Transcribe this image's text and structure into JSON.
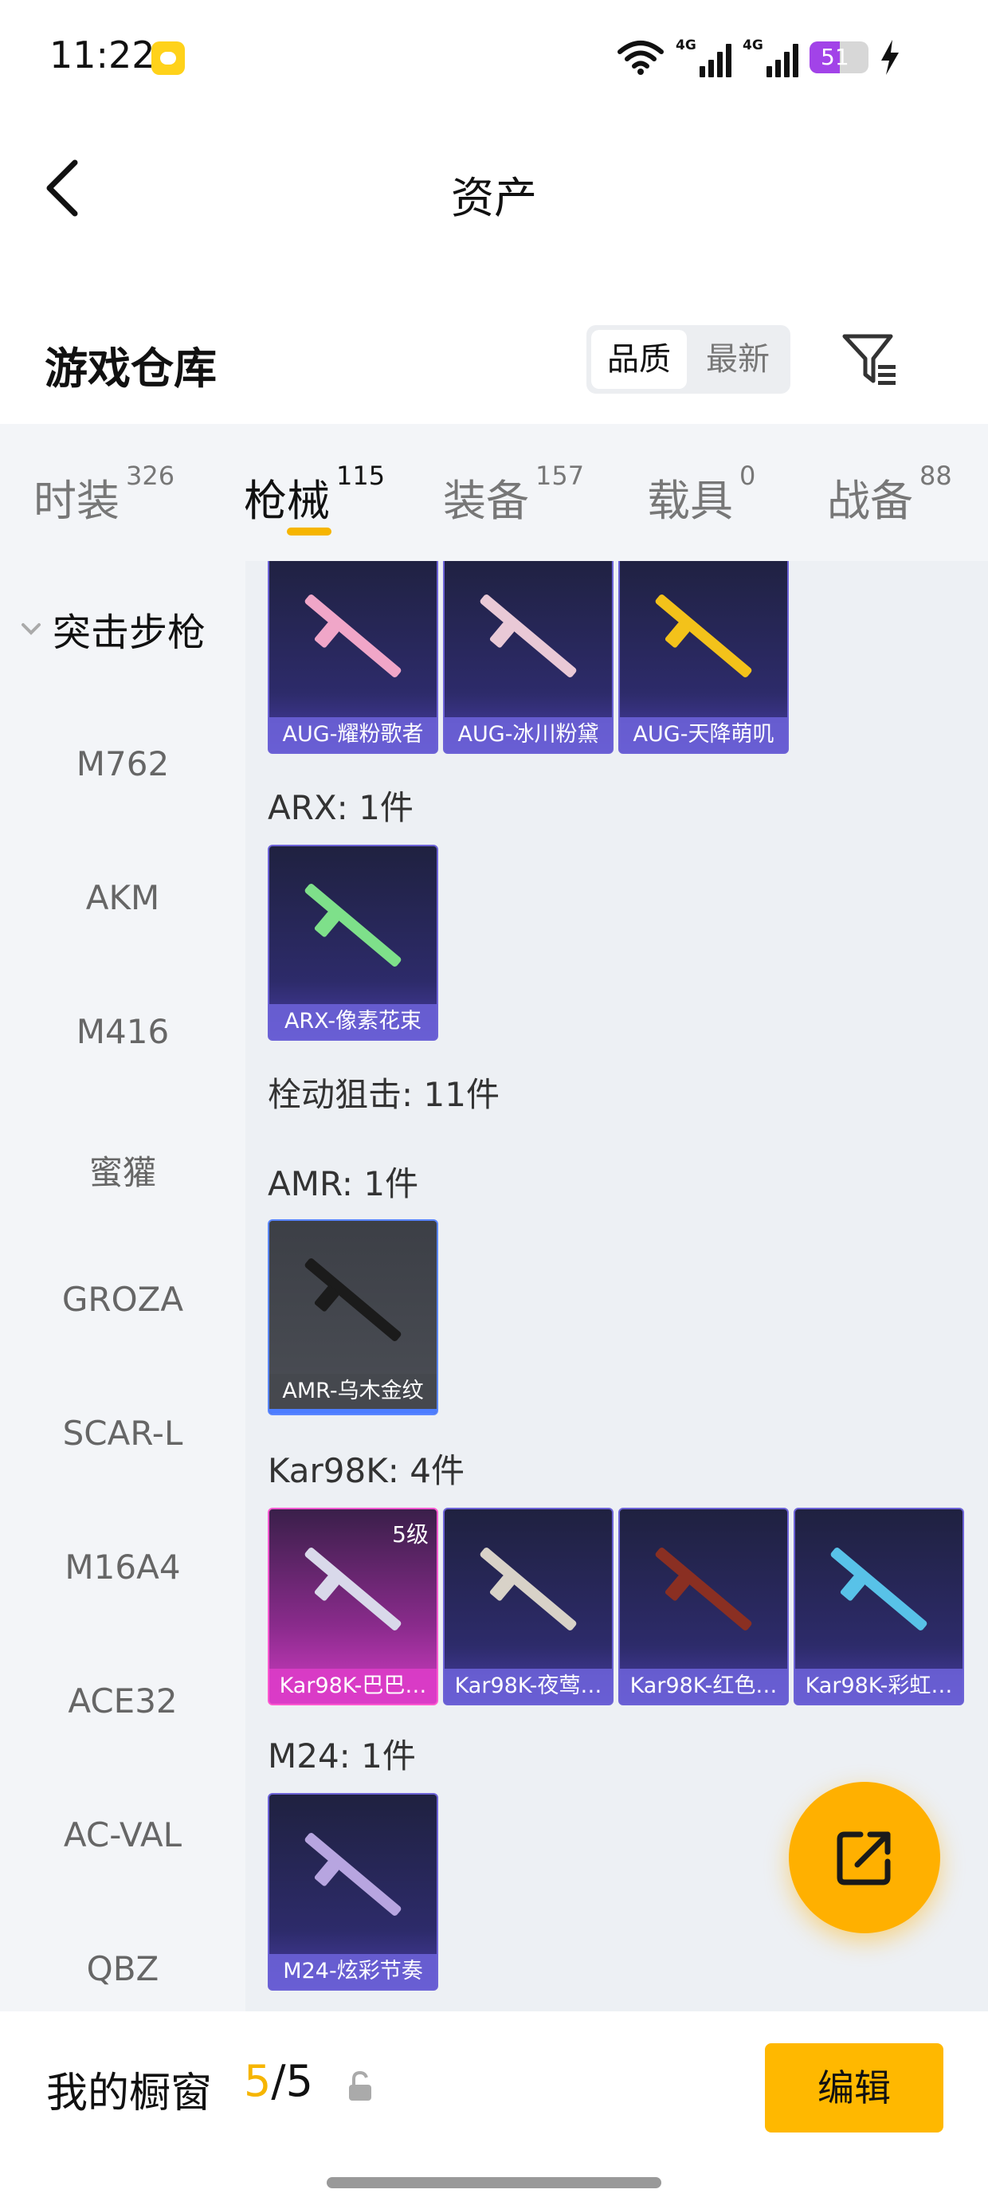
{
  "status_bar": {
    "time": "11:22",
    "network_1": "4G",
    "network_2": "4G",
    "battery_level": "51",
    "battery_fraction": 0.51,
    "icons": [
      "wifi-icon",
      "signal-icon",
      "battery-icon",
      "charging-icon"
    ]
  },
  "nav": {
    "title": "资产",
    "back_icon": "chevron-left-icon"
  },
  "warehouse": {
    "title": "游戏仓库",
    "sort_options": [
      "品质",
      "最新"
    ],
    "selected_sort": "品质",
    "filter_icon": "filter-icon"
  },
  "tabs": [
    {
      "label": "时装",
      "count": "326"
    },
    {
      "label": "枪械",
      "count": "115"
    },
    {
      "label": "装备",
      "count": "157"
    },
    {
      "label": "载具",
      "count": "0"
    },
    {
      "label": "战备",
      "count": "88"
    }
  ],
  "active_tab": "枪械",
  "sidebar": {
    "group": "突击步枪",
    "items": [
      "M762",
      "AKM",
      "M416",
      "蜜獾",
      "GROZA",
      "SCAR-L",
      "M16A4",
      "ACE32",
      "AC-VAL",
      "QBZ"
    ]
  },
  "content": {
    "sections": [
      {
        "label": "",
        "items": [
          {
            "name": "AUG-耀粉歌者",
            "style": "purple",
            "gun_color": "#f0a6c8"
          },
          {
            "name": "AUG-冰川粉黛",
            "style": "purple",
            "gun_color": "#e9c9d6"
          },
          {
            "name": "AUG-天降萌叽",
            "style": "purple",
            "gun_color": "#f3c21a"
          }
        ]
      },
      {
        "label": "ARX: 1件",
        "items": [
          {
            "name": "ARX-像素花束",
            "style": "purple",
            "gun_color": "#7ee08a"
          }
        ]
      },
      {
        "label": "栓动狙击: 11件",
        "items": []
      },
      {
        "label": "AMR: 1件",
        "items": [
          {
            "name": "AMR-乌木金纹",
            "style": "gray",
            "gun_color": "#1b1b1b"
          }
        ]
      },
      {
        "label": "Kar98K: 4件",
        "items": [
          {
            "name": "Kar98K-巴巴…",
            "style": "pink",
            "gun_color": "#d9d9ea",
            "level": "5级"
          },
          {
            "name": "Kar98K-夜莺…",
            "style": "purple",
            "gun_color": "#d8d2c8"
          },
          {
            "name": "Kar98K-红色…",
            "style": "purple",
            "gun_color": "#8a2f22"
          },
          {
            "name": "Kar98K-彩虹…",
            "style": "purple",
            "gun_color": "#58c2e8"
          }
        ]
      },
      {
        "label": "M24: 1件",
        "items": [
          {
            "name": "M24-炫彩节奏",
            "style": "purple",
            "gun_color": "#b7a5e0"
          }
        ]
      }
    ]
  },
  "fab": {
    "icon": "share-icon"
  },
  "bottom_bar": {
    "showcase_label": "我的橱窗",
    "current": "5",
    "separator": "/",
    "total": "5",
    "lock_icon": "lock-icon",
    "edit_label": "编辑"
  },
  "colors": {
    "accent": "#f6b500",
    "tab_bg": "#f3f5f8",
    "content_bg": "#edf0f4",
    "card_purple": "#2d2b6a",
    "card_pink": "#d23cc4",
    "card_gray": "#4b4e55"
  }
}
